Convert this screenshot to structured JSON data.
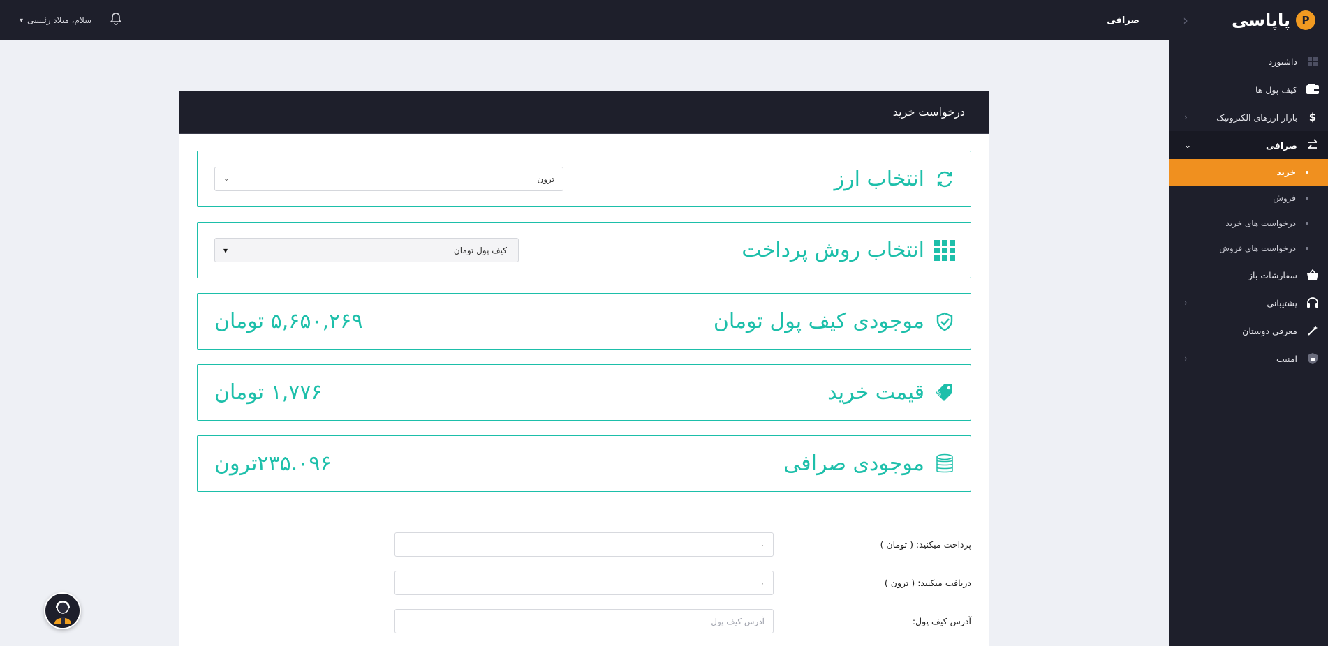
{
  "sidebar": {
    "brand_name": "پاپاسی",
    "brand_logo_letter": "P",
    "items": [
      {
        "label": "داشبورد",
        "icon": "dashboard-icon"
      },
      {
        "label": "کیف پول ها",
        "icon": "wallet-icon"
      },
      {
        "label": "بازار ارزهای الکترونیک",
        "icon": "dollar-icon"
      },
      {
        "label": "صرافی",
        "icon": "exchange-icon"
      },
      {
        "label": "سفارشات باز",
        "icon": "basket-icon"
      },
      {
        "label": "پشتیبانی",
        "icon": "headset-icon"
      },
      {
        "label": "معرفی دوستان",
        "icon": "magic-wand-icon"
      },
      {
        "label": "امنیت",
        "icon": "shield-lock-icon"
      }
    ],
    "subitems": [
      {
        "label": "خرید"
      },
      {
        "label": "فروش"
      },
      {
        "label": "درخواست های خرید"
      },
      {
        "label": "درخواست های فروش"
      }
    ]
  },
  "topbar": {
    "page_label": "صرافی",
    "user_greeting": "سلام، میلاد رئیسی"
  },
  "card": {
    "title": "درخواست خرید",
    "currency_select": {
      "title": "انتخاب ارز",
      "value": "ترون"
    },
    "payment_select": {
      "title": "انتخاب روش پرداخت",
      "value": "کیف پول تومان"
    },
    "wallet_balance": {
      "title": "موجودی کیف پول تومان",
      "value": "۵,۶۵۰,۲۶۹ تومان"
    },
    "buy_price": {
      "title": "قیمت خرید",
      "value": "۱,۷۷۶ تومان"
    },
    "exchange_balance": {
      "title": "موجودی صرافی",
      "value": "۲۳۵.۰۹۶ترون"
    }
  },
  "form": {
    "pay_label": "پرداخت میکنید: ( تومان )",
    "pay_value": "۰",
    "receive_label": "دریافت میکنید: ( ترون )",
    "receive_value": "۰",
    "address_label": "آدرس کیف پول:",
    "address_placeholder": "آدرس کیف پول"
  },
  "colors": {
    "accent": "#1dbfaa",
    "active_orange": "#f0901f",
    "dark_bg": "#1e1f2b"
  }
}
